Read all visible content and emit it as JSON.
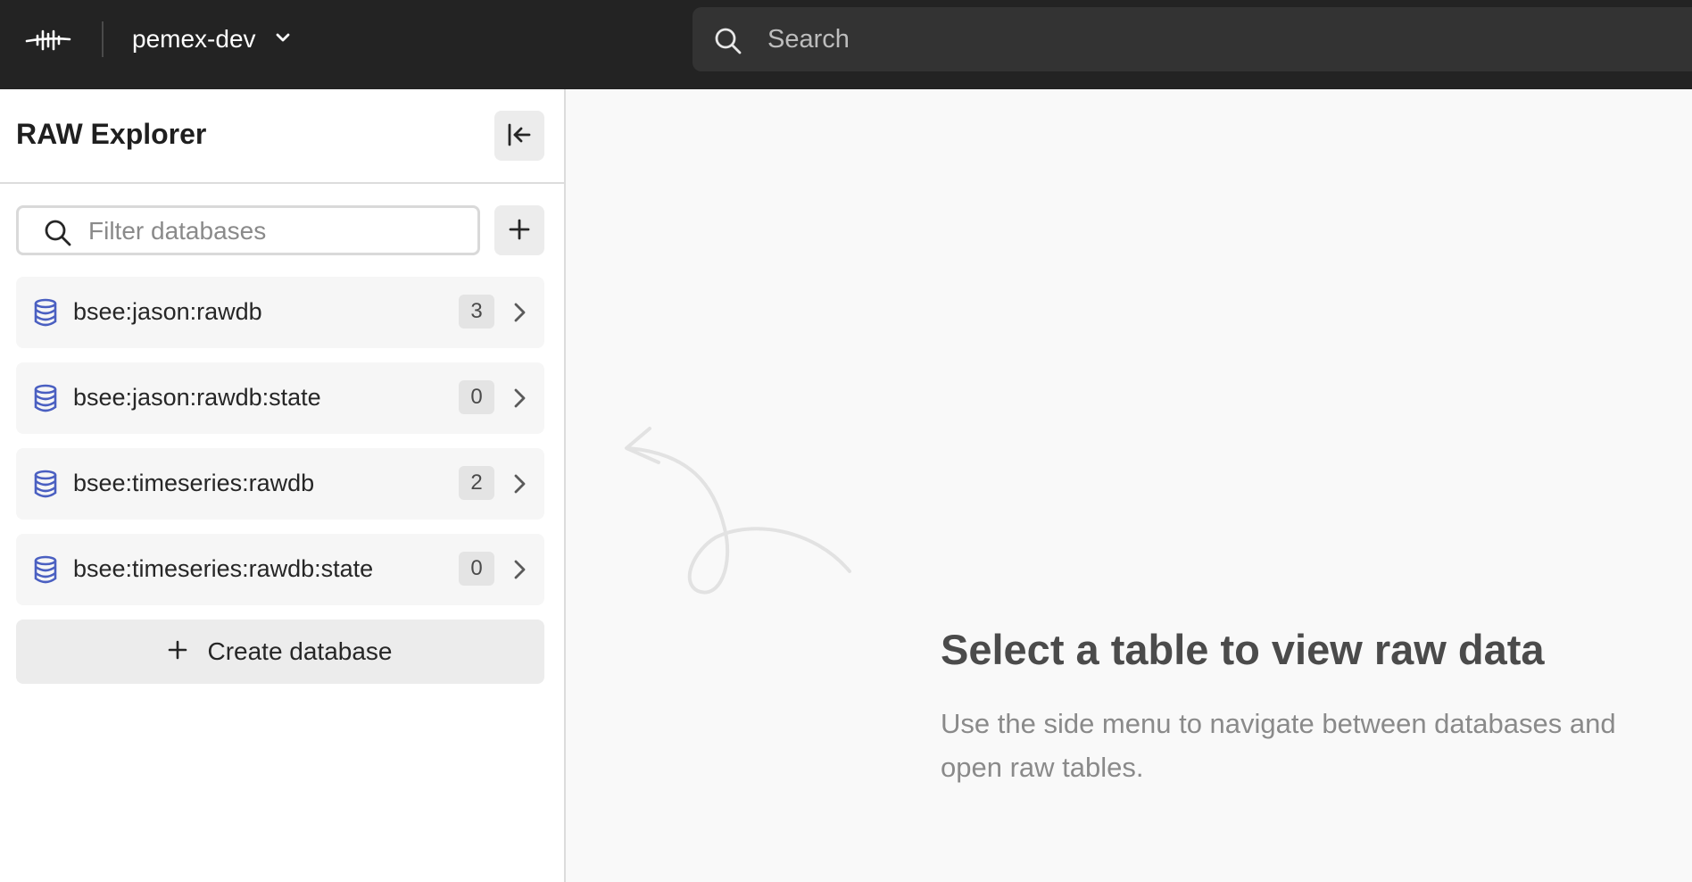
{
  "topbar": {
    "project_name": "pemex-dev",
    "search_placeholder": "Search"
  },
  "sidebar": {
    "title": "RAW Explorer",
    "filter_placeholder": "Filter databases",
    "databases": [
      {
        "name": "bsee:jason:rawdb",
        "count": "3"
      },
      {
        "name": "bsee:jason:rawdb:state",
        "count": "0"
      },
      {
        "name": "bsee:timeseries:rawdb",
        "count": "2"
      },
      {
        "name": "bsee:timeseries:rawdb:state",
        "count": "0"
      }
    ],
    "create_label": "Create database"
  },
  "main": {
    "empty_title": "Select a table to view raw data",
    "empty_description": "Use the side menu to navigate between databases and open raw tables."
  },
  "colors": {
    "topbar_bg": "#232323",
    "db_icon": "#4a5fc1"
  }
}
